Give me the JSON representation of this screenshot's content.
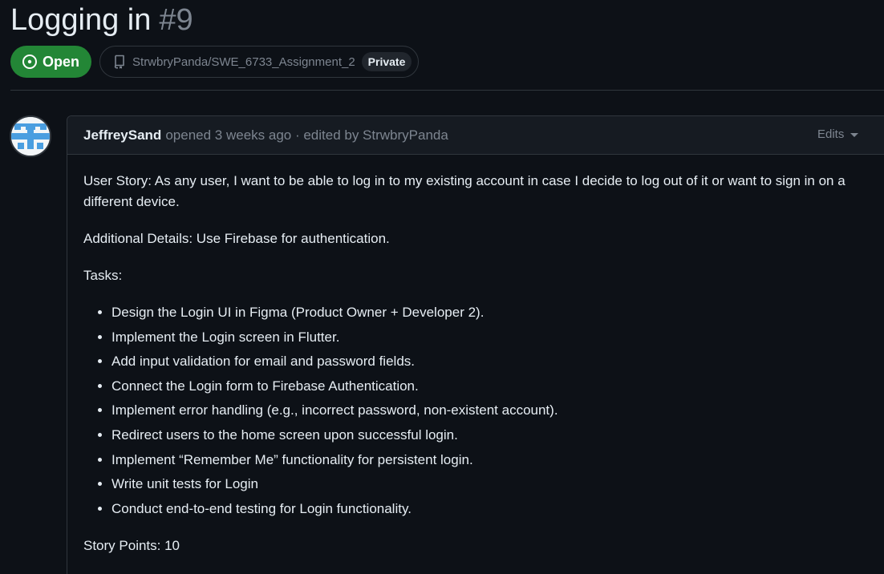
{
  "issue": {
    "title": "Logging in",
    "number": "#9",
    "state_label": "Open",
    "repo": "StrwbryPanda/SWE_6733_Assignment_2",
    "visibility": "Private"
  },
  "comment": {
    "author": "JeffreySand",
    "opened_text": "opened 3 weeks ago · edited by StrwbryPanda",
    "edits_label": "Edits",
    "user_story": "User Story: As any user, I want to be able to log in to my existing account in case I decide to log out of it or want to sign in on a different device.",
    "additional_details": "Additional Details: Use Firebase for authentication.",
    "tasks_heading": "Tasks:",
    "tasks": [
      "Design the Login UI in Figma (Product Owner + Developer 2).",
      "Implement the Login screen in Flutter.",
      "Add input validation for email and password fields.",
      "Connect the Login form to Firebase Authentication.",
      "Implement error handling (e.g., incorrect password, non-existent account).",
      "Redirect users to the home screen upon successful login.",
      "Implement “Remember Me” functionality for persistent login.",
      "Write unit tests for Login",
      "Conduct end-to-end testing for Login functionality."
    ],
    "story_points": "Story Points: 10"
  },
  "icons": {
    "state": "issue-opened-icon",
    "repo": "repo-icon",
    "avatar": "identicon-avatar",
    "edits": "chevron-down-icon"
  },
  "colors": {
    "background": "#0d1117",
    "open_green": "#238636",
    "border": "#30363d",
    "muted_text": "#7d8590",
    "primary_text": "#e6edf3",
    "avatar_blue": "#4a9ee0"
  }
}
